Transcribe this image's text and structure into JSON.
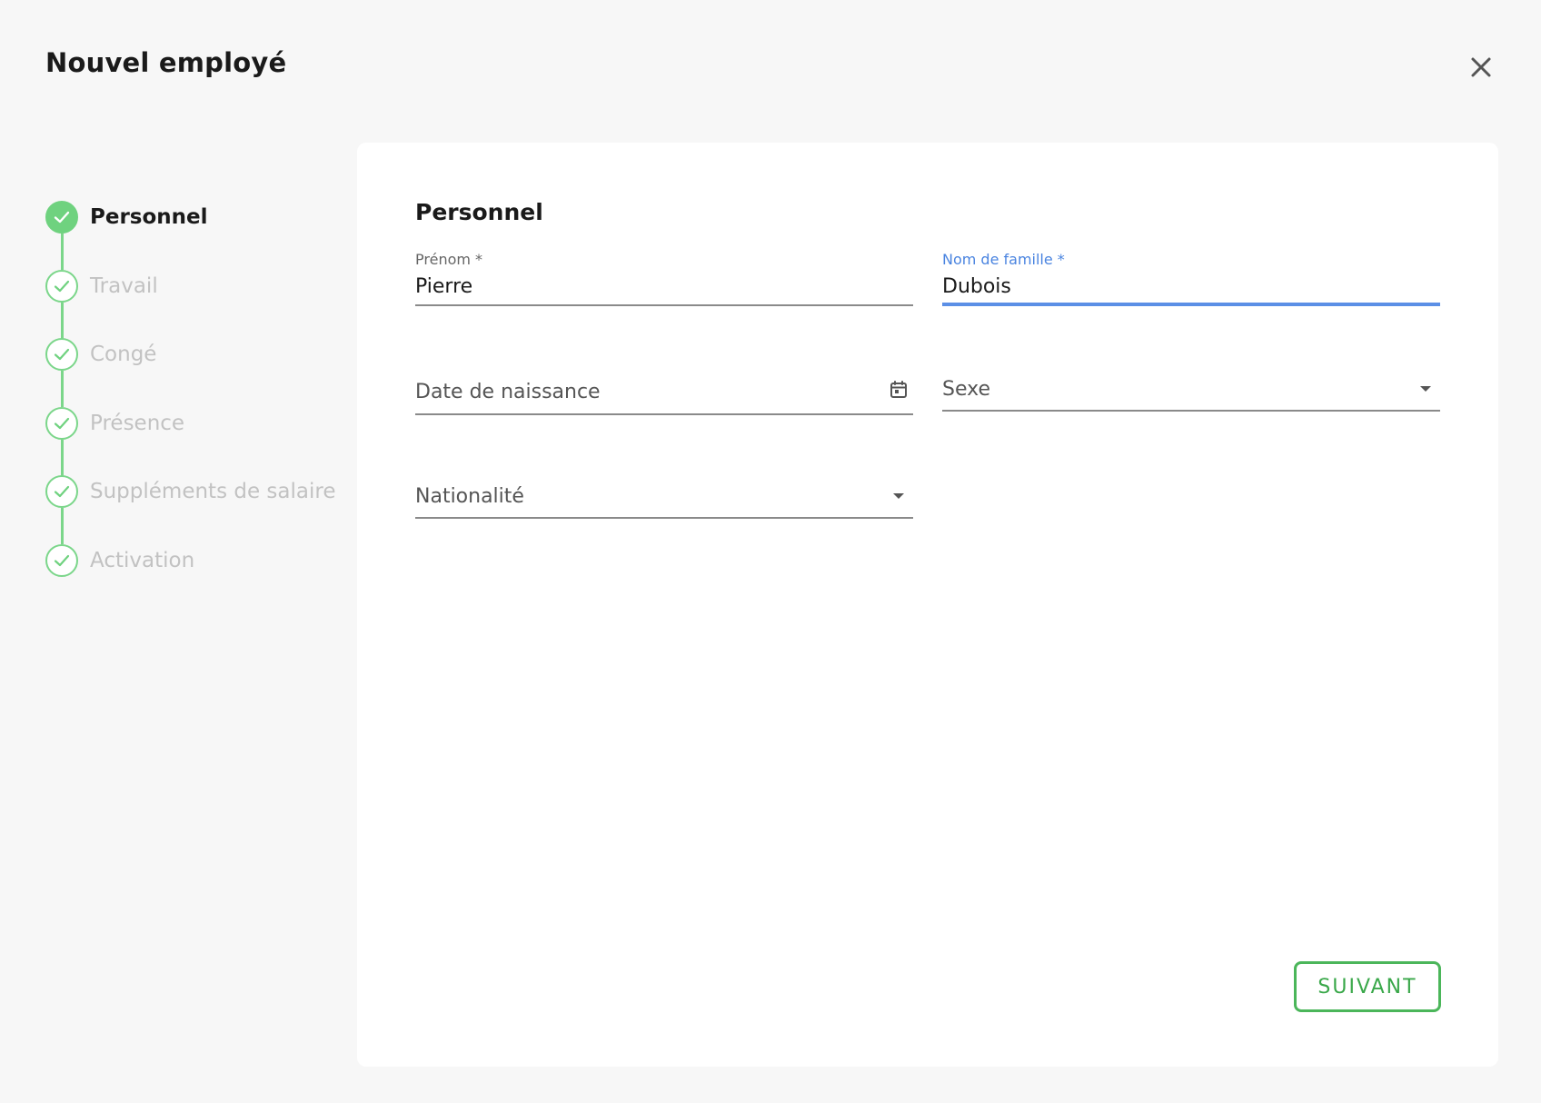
{
  "dialog": {
    "title": "Nouvel employé"
  },
  "stepper": {
    "steps": [
      {
        "label": "Personnel",
        "state": "active"
      },
      {
        "label": "Travail",
        "state": "completed"
      },
      {
        "label": "Congé",
        "state": "completed"
      },
      {
        "label": "Présence",
        "state": "completed"
      },
      {
        "label": "Suppléments de salaire",
        "state": "completed"
      },
      {
        "label": "Activation",
        "state": "completed"
      }
    ]
  },
  "form": {
    "section_title": "Personnel",
    "first_name": {
      "label": "Prénom *",
      "value": "Pierre"
    },
    "last_name": {
      "label": "Nom de famille *",
      "value": "Dubois",
      "focused": true
    },
    "birth_date": {
      "placeholder": "Date de naissance",
      "icon": "calendar-icon"
    },
    "gender": {
      "placeholder": "Sexe",
      "icon": "dropdown-arrow-icon"
    },
    "nationality": {
      "placeholder": "Nationalité",
      "icon": "dropdown-arrow-icon"
    }
  },
  "actions": {
    "next_label": "SUIVANT"
  },
  "colors": {
    "step_green": "#6fd27f",
    "focus_blue": "#5b8fe6",
    "button_green": "#4bb65a"
  }
}
